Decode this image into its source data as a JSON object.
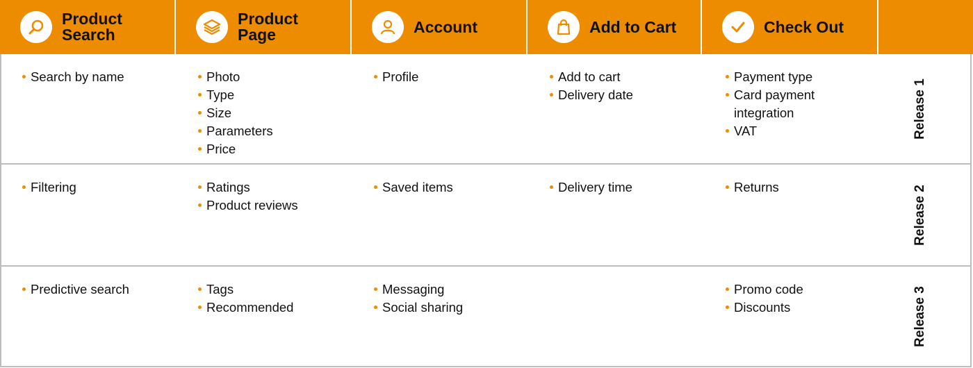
{
  "accent_color": "#EE8C00",
  "columns": [
    {
      "title_line1": "Product",
      "title_line2": "Search",
      "icon": "search-icon"
    },
    {
      "title_line1": "Product",
      "title_line2": "Page",
      "icon": "layers-icon"
    },
    {
      "title_line1": "Account",
      "title_line2": "",
      "icon": "user-icon"
    },
    {
      "title_line1": "Add to Cart",
      "title_line2": "",
      "icon": "shopping-bag-icon"
    },
    {
      "title_line1": "Check Out",
      "title_line2": "",
      "icon": "check-icon"
    }
  ],
  "releases": [
    {
      "label": "Release 1",
      "cells": [
        [
          "Search by name"
        ],
        [
          "Photo",
          "Type",
          "Size",
          "Parameters",
          "Price"
        ],
        [
          "Profile"
        ],
        [
          "Add to cart",
          "Delivery date"
        ],
        [
          "Payment type",
          "Card payment integration",
          "VAT"
        ]
      ]
    },
    {
      "label": "Release 2",
      "cells": [
        [
          "Filtering"
        ],
        [
          "Ratings",
          "Product reviews"
        ],
        [
          "Saved items"
        ],
        [
          "Delivery time"
        ],
        [
          "Returns"
        ]
      ]
    },
    {
      "label": "Release 3",
      "cells": [
        [
          "Predictive search"
        ],
        [
          "Tags",
          "Recommended"
        ],
        [
          "Messaging",
          "Social sharing"
        ],
        [],
        [
          "Promo code",
          "Discounts"
        ]
      ]
    }
  ]
}
